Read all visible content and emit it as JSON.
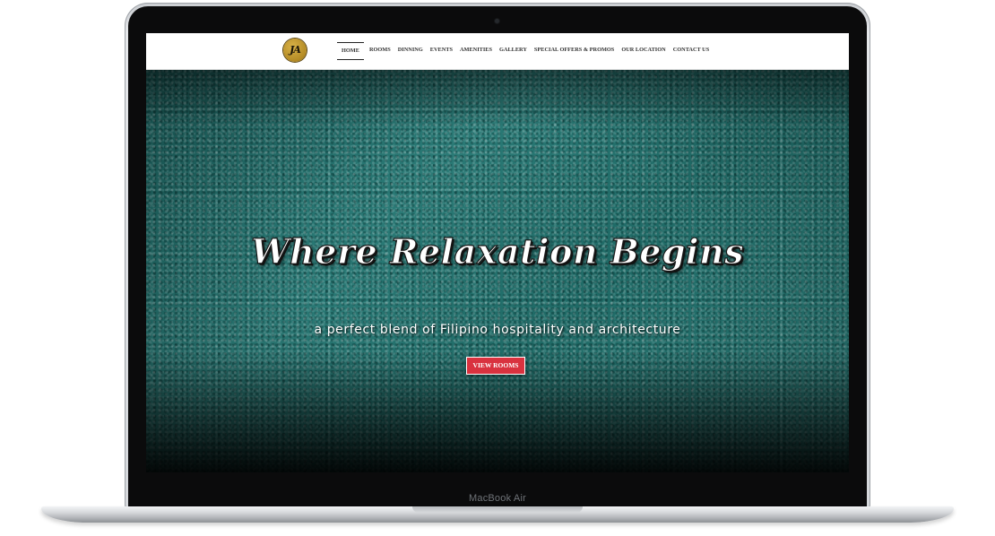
{
  "device": {
    "model_label": "MacBook Air"
  },
  "site": {
    "logo_text": "JA",
    "nav": [
      {
        "label": "HOME",
        "active": true
      },
      {
        "label": "ROOMS"
      },
      {
        "label": "DINNING"
      },
      {
        "label": "EVENTS"
      },
      {
        "label": "AMENITIES"
      },
      {
        "label": "GALLERY"
      },
      {
        "label": "SPECIAL OFFERS & PROMOS"
      },
      {
        "label": "OUR LOCATION"
      },
      {
        "label": "CONTACT US"
      }
    ],
    "hero": {
      "title": "Where Relaxation Begins",
      "subtitle": "a perfect blend of Filipino hospitality and architecture",
      "cta_label": "VIEW ROOMS"
    }
  },
  "colors": {
    "accent": "#d9323f",
    "hero_teal": "#1d6a67",
    "logo_gold": "#b38a24"
  }
}
